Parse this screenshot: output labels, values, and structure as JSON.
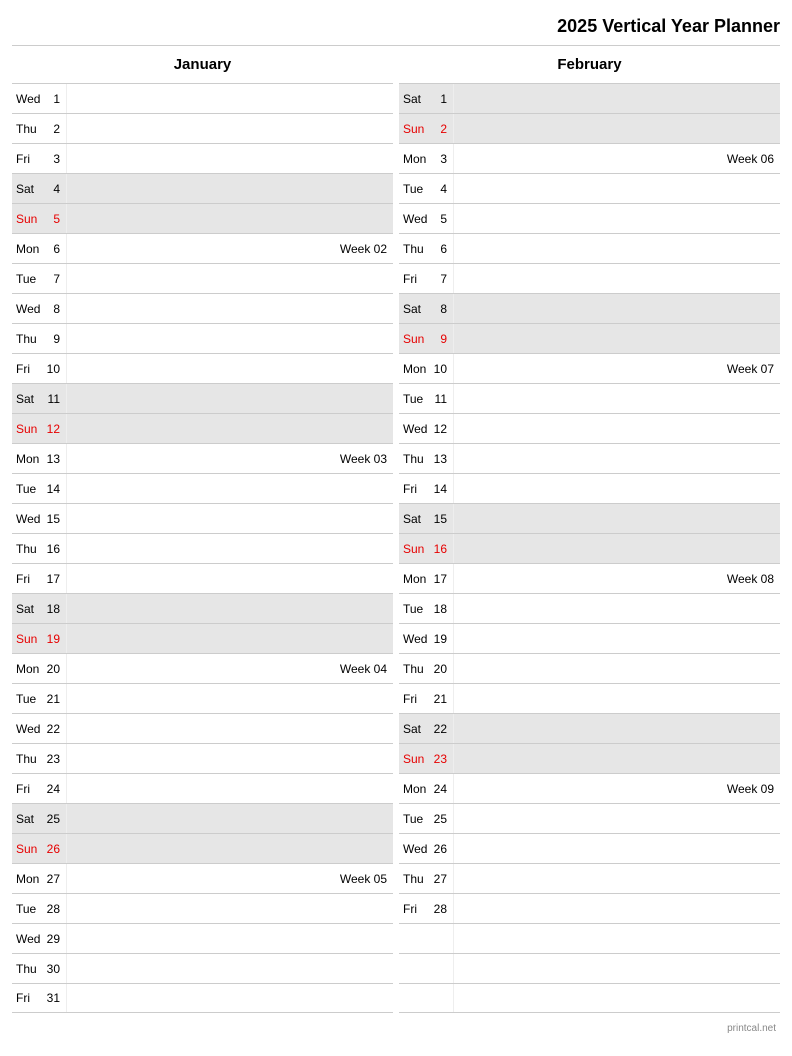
{
  "title": "2025 Vertical Year Planner",
  "footer": "printcal.net",
  "months": [
    {
      "name": "January",
      "days": [
        {
          "dow": "Wed",
          "n": 1
        },
        {
          "dow": "Thu",
          "n": 2
        },
        {
          "dow": "Fri",
          "n": 3
        },
        {
          "dow": "Sat",
          "n": 4,
          "weekend": true
        },
        {
          "dow": "Sun",
          "n": 5,
          "weekend": true,
          "sun": true
        },
        {
          "dow": "Mon",
          "n": 6,
          "note": "Week 02"
        },
        {
          "dow": "Tue",
          "n": 7
        },
        {
          "dow": "Wed",
          "n": 8
        },
        {
          "dow": "Thu",
          "n": 9
        },
        {
          "dow": "Fri",
          "n": 10
        },
        {
          "dow": "Sat",
          "n": 11,
          "weekend": true
        },
        {
          "dow": "Sun",
          "n": 12,
          "weekend": true,
          "sun": true
        },
        {
          "dow": "Mon",
          "n": 13,
          "note": "Week 03"
        },
        {
          "dow": "Tue",
          "n": 14
        },
        {
          "dow": "Wed",
          "n": 15
        },
        {
          "dow": "Thu",
          "n": 16
        },
        {
          "dow": "Fri",
          "n": 17
        },
        {
          "dow": "Sat",
          "n": 18,
          "weekend": true
        },
        {
          "dow": "Sun",
          "n": 19,
          "weekend": true,
          "sun": true
        },
        {
          "dow": "Mon",
          "n": 20,
          "note": "Week 04"
        },
        {
          "dow": "Tue",
          "n": 21
        },
        {
          "dow": "Wed",
          "n": 22
        },
        {
          "dow": "Thu",
          "n": 23
        },
        {
          "dow": "Fri",
          "n": 24
        },
        {
          "dow": "Sat",
          "n": 25,
          "weekend": true
        },
        {
          "dow": "Sun",
          "n": 26,
          "weekend": true,
          "sun": true
        },
        {
          "dow": "Mon",
          "n": 27,
          "note": "Week 05"
        },
        {
          "dow": "Tue",
          "n": 28
        },
        {
          "dow": "Wed",
          "n": 29
        },
        {
          "dow": "Thu",
          "n": 30
        },
        {
          "dow": "Fri",
          "n": 31
        }
      ]
    },
    {
      "name": "February",
      "days": [
        {
          "dow": "Sat",
          "n": 1,
          "weekend": true
        },
        {
          "dow": "Sun",
          "n": 2,
          "weekend": true,
          "sun": true
        },
        {
          "dow": "Mon",
          "n": 3,
          "note": "Week 06"
        },
        {
          "dow": "Tue",
          "n": 4
        },
        {
          "dow": "Wed",
          "n": 5
        },
        {
          "dow": "Thu",
          "n": 6
        },
        {
          "dow": "Fri",
          "n": 7
        },
        {
          "dow": "Sat",
          "n": 8,
          "weekend": true
        },
        {
          "dow": "Sun",
          "n": 9,
          "weekend": true,
          "sun": true
        },
        {
          "dow": "Mon",
          "n": 10,
          "note": "Week 07"
        },
        {
          "dow": "Tue",
          "n": 11
        },
        {
          "dow": "Wed",
          "n": 12
        },
        {
          "dow": "Thu",
          "n": 13
        },
        {
          "dow": "Fri",
          "n": 14
        },
        {
          "dow": "Sat",
          "n": 15,
          "weekend": true
        },
        {
          "dow": "Sun",
          "n": 16,
          "weekend": true,
          "sun": true
        },
        {
          "dow": "Mon",
          "n": 17,
          "note": "Week 08"
        },
        {
          "dow": "Tue",
          "n": 18
        },
        {
          "dow": "Wed",
          "n": 19
        },
        {
          "dow": "Thu",
          "n": 20
        },
        {
          "dow": "Fri",
          "n": 21
        },
        {
          "dow": "Sat",
          "n": 22,
          "weekend": true
        },
        {
          "dow": "Sun",
          "n": 23,
          "weekend": true,
          "sun": true
        },
        {
          "dow": "Mon",
          "n": 24,
          "note": "Week 09"
        },
        {
          "dow": "Tue",
          "n": 25
        },
        {
          "dow": "Wed",
          "n": 26
        },
        {
          "dow": "Thu",
          "n": 27
        },
        {
          "dow": "Fri",
          "n": 28
        },
        {
          "empty": true
        },
        {
          "empty": true
        },
        {
          "empty": true
        }
      ]
    }
  ]
}
